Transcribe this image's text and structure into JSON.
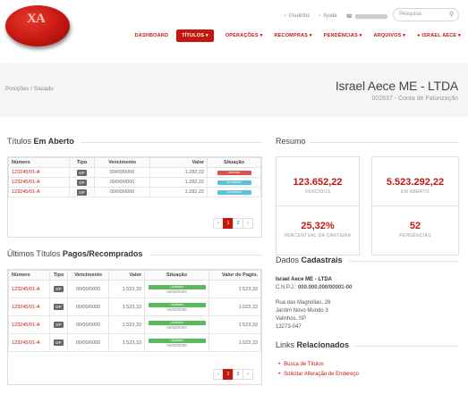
{
  "brand": {
    "logo_text": "XA"
  },
  "utility": {
    "users": "Usuários",
    "help": "Ajuda",
    "search_placeholder": "Pesquisa"
  },
  "nav": {
    "items": [
      "DASHBOARD",
      "TÍTULOS",
      "OPERAÇÕES",
      "RECOMPRAS",
      "PENDÊNCIAS",
      "ARQUIVOS",
      "ISRAEL AECE"
    ]
  },
  "header": {
    "breadcrumb": "Posições / Sacado",
    "title": "Israel Aece ME - LTDA",
    "subtitle": "002837 - Conta de Faturização"
  },
  "open_titles": {
    "title_prefix": "Títulos",
    "title_bold": "Em Aberto",
    "columns": [
      "Número",
      "Tipo",
      "Vencimento",
      "Valor",
      "Situação"
    ],
    "rows": [
      {
        "number": "123245/01-A",
        "type": "DP",
        "due": "00/00/0000",
        "value": "1.282,22",
        "status": "Vencido",
        "status_kind": "red"
      },
      {
        "number": "123245/01-A",
        "type": "DP",
        "due": "00/00/0000",
        "value": "1.282,22",
        "status": "Em Aberto",
        "status_kind": "blue"
      },
      {
        "number": "123245/01-A",
        "type": "DP",
        "due": "00/00/0000",
        "value": "1.282,22",
        "status": "Em Aberto",
        "status_kind": "blue"
      }
    ],
    "pages": [
      "1",
      "2"
    ]
  },
  "paid_titles": {
    "title_prefix": "Últimos Títulos",
    "title_bold": "Pagos/Recomprados",
    "columns": [
      "Número",
      "Tipo",
      "Vencimento",
      "Valor",
      "Situação",
      "Valor do Pagto."
    ],
    "rows": [
      {
        "number": "123245/01-A",
        "type": "DP",
        "due": "00/00/0000",
        "value": "1.523,33",
        "status": "Liquidado",
        "status_date": "00/00/0000",
        "paid": "1.523,33"
      },
      {
        "number": "123245/01-A",
        "type": "DP",
        "due": "00/00/0000",
        "value": "1.523,33",
        "status": "Liquidado",
        "status_date": "00/00/0000",
        "paid": "1.523,33"
      },
      {
        "number": "123245/01-A",
        "type": "DP",
        "due": "00/00/0000",
        "value": "1.523,33",
        "status": "Liquidado",
        "status_date": "00/00/0000",
        "paid": "1.523,33"
      },
      {
        "number": "123245/01-A",
        "type": "DP",
        "due": "00/00/0000",
        "value": "1.523,33",
        "status": "Liquidado",
        "status_date": "00/00/0000",
        "paid": "1.523,33"
      }
    ],
    "pages": [
      "1",
      "2"
    ]
  },
  "summary": {
    "title": "Resumo",
    "cards": [
      {
        "value": "123.652,22",
        "label": "VENCIDOS"
      },
      {
        "value": "5.523.292,22",
        "label": "EM ABERTO"
      },
      {
        "value": "25,32%",
        "label": "PERCENTUAL DA CARTEIRA"
      },
      {
        "value": "52",
        "label": "PENDÊNCIAS"
      }
    ]
  },
  "registration": {
    "title_prefix": "Dados",
    "title_bold": "Cadastrais",
    "company": "Israel Aece ME - LTDA",
    "cnpj_label": "C.N.P.J.:",
    "cnpj": "000.000.000/00001-00",
    "address": [
      "Rua das Magnólias, 28",
      "Jardim Novo Mundo 3",
      "Valinhos, SP",
      "13273-047"
    ]
  },
  "related": {
    "title_prefix": "Links",
    "title_bold": "Relacionados",
    "links": [
      "Busca de Títulos",
      "Solicitar Alteração de Endereço"
    ]
  },
  "colors": {
    "accent": "#c4170f",
    "overdue": "#d9534f",
    "open": "#5bc0de",
    "paid": "#5cb85c"
  }
}
